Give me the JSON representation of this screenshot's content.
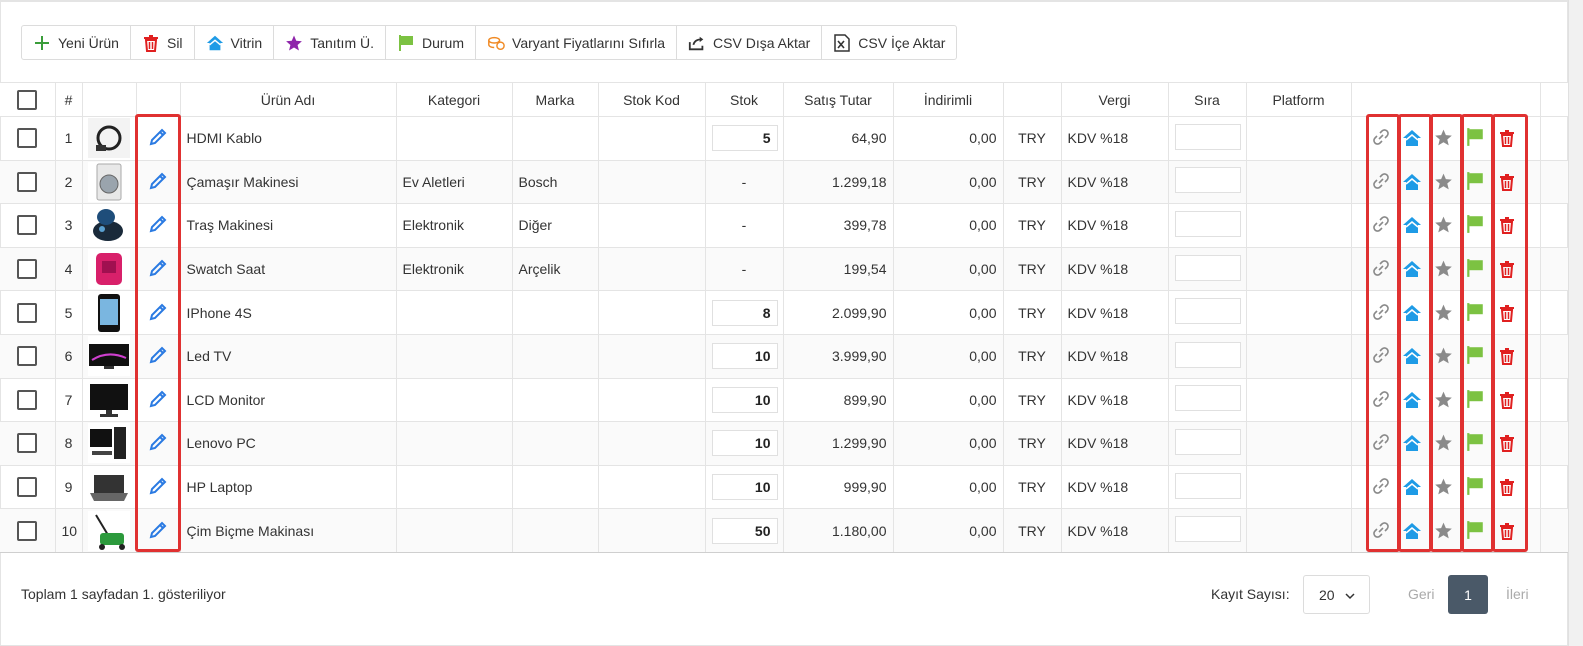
{
  "toolbar": {
    "new_product": "Yeni Ürün",
    "delete": "Sil",
    "showcase": "Vitrin",
    "promo": "Tanıtım Ü.",
    "status": "Durum",
    "reset_variant": "Varyant Fiyatlarını Sıfırla",
    "csv_export": "CSV Dışa Aktar",
    "csv_import": "CSV İçe Aktar"
  },
  "table": {
    "headers": {
      "index": "#",
      "name": "Ürün Adı",
      "category": "Kategori",
      "brand": "Marka",
      "stock_code": "Stok Kod",
      "stock": "Stok",
      "price": "Satış Tutar",
      "discounted": "İndirimli",
      "tax": "Vergi",
      "order": "Sıra",
      "platform": "Platform"
    },
    "rows": [
      {
        "no": "1",
        "name": "HDMI Kablo",
        "category": "",
        "brand": "",
        "stock_code": "",
        "stock": "5",
        "price": "64,90",
        "discounted": "0,00",
        "currency": "TRY",
        "tax": "KDV %18",
        "thumb": "hdmi-cable"
      },
      {
        "no": "2",
        "name": "Çamaşır Makinesi",
        "category": "Ev Aletleri",
        "brand": "Bosch",
        "stock_code": "",
        "stock": "-",
        "price": "1.299,18",
        "discounted": "0,00",
        "currency": "TRY",
        "tax": "KDV %18",
        "thumb": "washing-machine"
      },
      {
        "no": "3",
        "name": "Traş Makinesi",
        "category": "Elektronik",
        "brand": "Diğer",
        "stock_code": "",
        "stock": "-",
        "price": "399,78",
        "discounted": "0,00",
        "currency": "TRY",
        "tax": "KDV %18",
        "thumb": "shaver"
      },
      {
        "no": "4",
        "name": "Swatch Saat",
        "category": "Elektronik",
        "brand": "Arçelik",
        "stock_code": "",
        "stock": "-",
        "price": "199,54",
        "discounted": "0,00",
        "currency": "TRY",
        "tax": "KDV %18",
        "thumb": "watch"
      },
      {
        "no": "5",
        "name": "IPhone 4S",
        "category": "",
        "brand": "",
        "stock_code": "",
        "stock": "8",
        "price": "2.099,90",
        "discounted": "0,00",
        "currency": "TRY",
        "tax": "KDV %18",
        "thumb": "phone"
      },
      {
        "no": "6",
        "name": "Led TV",
        "category": "",
        "brand": "",
        "stock_code": "",
        "stock": "10",
        "price": "3.999,90",
        "discounted": "0,00",
        "currency": "TRY",
        "tax": "KDV %18",
        "thumb": "tv"
      },
      {
        "no": "7",
        "name": "LCD Monitor",
        "category": "",
        "brand": "",
        "stock_code": "",
        "stock": "10",
        "price": "899,90",
        "discounted": "0,00",
        "currency": "TRY",
        "tax": "KDV %18",
        "thumb": "monitor"
      },
      {
        "no": "8",
        "name": "Lenovo PC",
        "category": "",
        "brand": "",
        "stock_code": "",
        "stock": "10",
        "price": "1.299,90",
        "discounted": "0,00",
        "currency": "TRY",
        "tax": "KDV %18",
        "thumb": "desktop-pc"
      },
      {
        "no": "9",
        "name": "HP Laptop",
        "category": "",
        "brand": "",
        "stock_code": "",
        "stock": "10",
        "price": "999,90",
        "discounted": "0,00",
        "currency": "TRY",
        "tax": "KDV %18",
        "thumb": "laptop"
      },
      {
        "no": "10",
        "name": "Çim Biçme Makinası",
        "category": "",
        "brand": "",
        "stock_code": "",
        "stock": "50",
        "price": "1.180,00",
        "discounted": "0,00",
        "currency": "TRY",
        "tax": "KDV %18",
        "thumb": "lawn-mower"
      }
    ]
  },
  "footer": {
    "summary": "Toplam 1 sayfadan 1. gösteriliyor",
    "records_label": "Kayıt Sayısı:",
    "records_value": "20",
    "prev": "Geri",
    "current_page": "1",
    "next": "İleri"
  },
  "colors": {
    "edit_blue": "#2a7ae2",
    "home_blue": "#1e9be6",
    "star_gray": "#8a8a8a",
    "flag_green": "#7cc242",
    "trash_red": "#e02020",
    "highlight_red": "#e03131",
    "page_active": "#4a5968"
  }
}
